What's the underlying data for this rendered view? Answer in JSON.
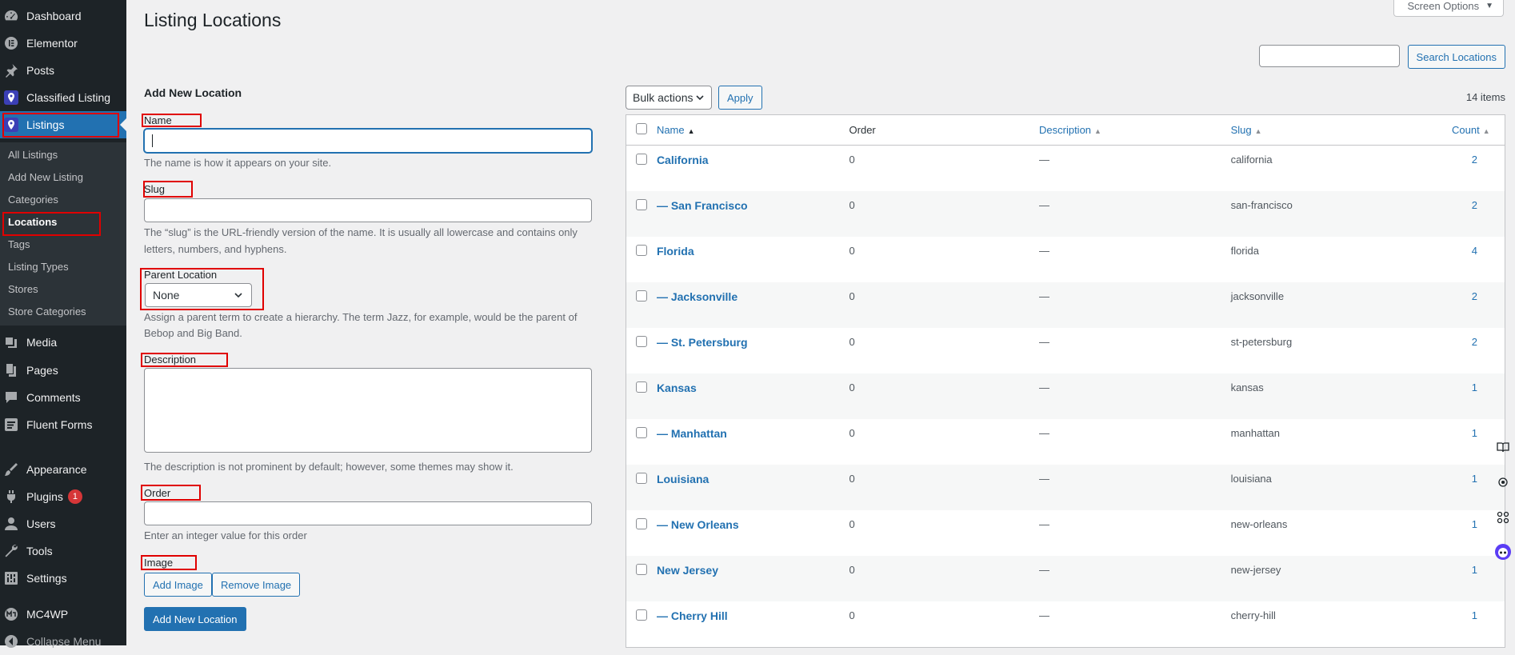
{
  "sidebar": {
    "items": [
      {
        "label": "Dashboard",
        "icon": "dashboard-icon"
      },
      {
        "label": "Elementor",
        "icon": "elementor-icon"
      },
      {
        "label": "Posts",
        "icon": "pin-icon"
      },
      {
        "label": "Classified Listing",
        "icon": "classified-listing-icon"
      },
      {
        "label": "Listings",
        "icon": "listings-icon"
      },
      {
        "label": "Media",
        "icon": "media-icon"
      },
      {
        "label": "Pages",
        "icon": "pages-icon"
      },
      {
        "label": "Comments",
        "icon": "comments-icon"
      },
      {
        "label": "Fluent Forms",
        "icon": "fluent-forms-icon"
      },
      {
        "label": "Appearance",
        "icon": "appearance-icon"
      },
      {
        "label": "Plugins",
        "icon": "plugins-icon",
        "badge": "1"
      },
      {
        "label": "Users",
        "icon": "users-icon"
      },
      {
        "label": "Tools",
        "icon": "tools-icon"
      },
      {
        "label": "Settings",
        "icon": "settings-icon"
      },
      {
        "label": "MC4WP",
        "icon": "mc4wp-icon"
      },
      {
        "label": "Collapse Menu",
        "icon": "collapse-icon"
      }
    ],
    "submenu": [
      "All Listings",
      "Add New Listing",
      "Categories",
      "Locations",
      "Tags",
      "Listing Types",
      "Stores",
      "Store Categories"
    ]
  },
  "page": {
    "title": "Listing Locations",
    "screen_options": "Screen Options",
    "search_button": "Search Locations"
  },
  "form": {
    "heading": "Add New Location",
    "name_label": "Name",
    "name_help": "The name is how it appears on your site.",
    "slug_label": "Slug",
    "slug_help_1": "The “slug” is the URL-friendly version of the name. It is usually all lowercase and contains only",
    "slug_help_2": "letters, numbers, and hyphens.",
    "parent_label": "Parent Location",
    "parent_value": "None",
    "parent_help_1": "Assign a parent term to create a hierarchy. The term Jazz, for example, would be the parent of",
    "parent_help_2": "Bebop and Big Band.",
    "description_label": "Description",
    "description_help": "The description is not prominent by default; however, some themes may show it.",
    "order_label": "Order",
    "order_help": "Enter an integer value for this order",
    "image_label": "Image",
    "add_image": "Add Image",
    "remove_image": "Remove Image",
    "submit": "Add New Location"
  },
  "table": {
    "bulk_actions": "Bulk actions",
    "apply": "Apply",
    "items_count": "14 items",
    "headers": {
      "name": "Name",
      "order": "Order",
      "description": "Description",
      "slug": "Slug",
      "count": "Count"
    },
    "rows": [
      {
        "name": "California",
        "order": "0",
        "description": "—",
        "slug": "california",
        "count": "2"
      },
      {
        "name": "— San Francisco",
        "order": "0",
        "description": "—",
        "slug": "san-francisco",
        "count": "2"
      },
      {
        "name": "Florida",
        "order": "0",
        "description": "—",
        "slug": "florida",
        "count": "4"
      },
      {
        "name": "— Jacksonville",
        "order": "0",
        "description": "—",
        "slug": "jacksonville",
        "count": "2"
      },
      {
        "name": "— St. Petersburg",
        "order": "0",
        "description": "—",
        "slug": "st-petersburg",
        "count": "2"
      },
      {
        "name": "Kansas",
        "order": "0",
        "description": "—",
        "slug": "kansas",
        "count": "1"
      },
      {
        "name": "— Manhattan",
        "order": "0",
        "description": "—",
        "slug": "manhattan",
        "count": "1"
      },
      {
        "name": "Louisiana",
        "order": "0",
        "description": "—",
        "slug": "louisiana",
        "count": "1"
      },
      {
        "name": "— New Orleans",
        "order": "0",
        "description": "—",
        "slug": "new-orleans",
        "count": "1"
      },
      {
        "name": "New Jersey",
        "order": "0",
        "description": "—",
        "slug": "new-jersey",
        "count": "1"
      },
      {
        "name": "— Cherry Hill",
        "order": "0",
        "description": "—",
        "slug": "cherry-hill",
        "count": "1"
      }
    ]
  },
  "colors": {
    "accent": "#2271b1",
    "sidebar": "#1d2327",
    "highlight": "#e00000"
  }
}
